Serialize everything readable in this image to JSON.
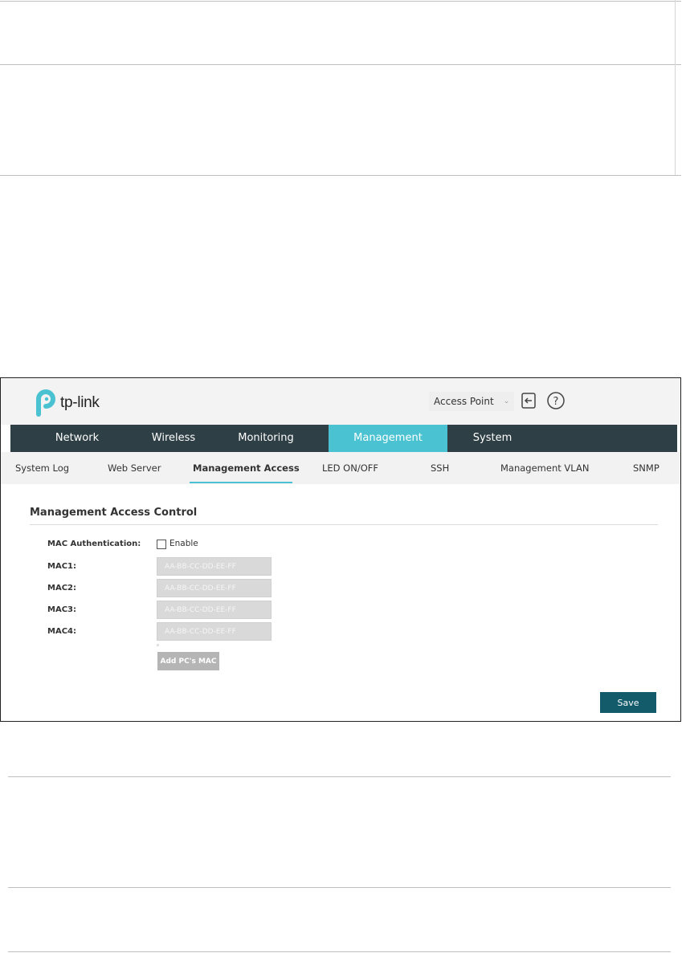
{
  "header": {
    "logo_text": "tp-link",
    "mode_select": "Access Point",
    "icons": [
      "logout-icon",
      "help-icon"
    ]
  },
  "main_nav": {
    "tabs": [
      {
        "label": "Network"
      },
      {
        "label": "Wireless"
      },
      {
        "label": "Monitoring"
      },
      {
        "label": "Management",
        "active": true
      },
      {
        "label": "System"
      }
    ]
  },
  "sub_nav": {
    "tabs": [
      {
        "label": "System Log"
      },
      {
        "label": "Web Server"
      },
      {
        "label": "Management Access",
        "active": true
      },
      {
        "label": "LED ON/OFF"
      },
      {
        "label": "SSH"
      },
      {
        "label": "Management VLAN"
      },
      {
        "label": "SNMP"
      }
    ]
  },
  "form": {
    "section_title": "Management Access Control",
    "mac_auth_label": "MAC Authentication:",
    "enable_label": "Enable",
    "enable_checked": false,
    "mac_fields": [
      {
        "label": "MAC1:",
        "value": "",
        "placeholder": "AA-BB-CC-DD-EE-FF"
      },
      {
        "label": "MAC2:",
        "value": "",
        "placeholder": "AA-BB-CC-DD-EE-FF"
      },
      {
        "label": "MAC3:",
        "value": "",
        "placeholder": "AA-BB-CC-DD-EE-FF"
      },
      {
        "label": "MAC4:",
        "value": "",
        "placeholder": "AA-BB-CC-DD-EE-FF"
      }
    ],
    "add_pc_mac_label": "Add PC's MAC",
    "save_label": "Save"
  },
  "colors": {
    "nav_bg": "#2e3f45",
    "nav_active": "#4ac2d1",
    "save_button": "#135b6a",
    "logo_accent": "#4ac2d1"
  }
}
